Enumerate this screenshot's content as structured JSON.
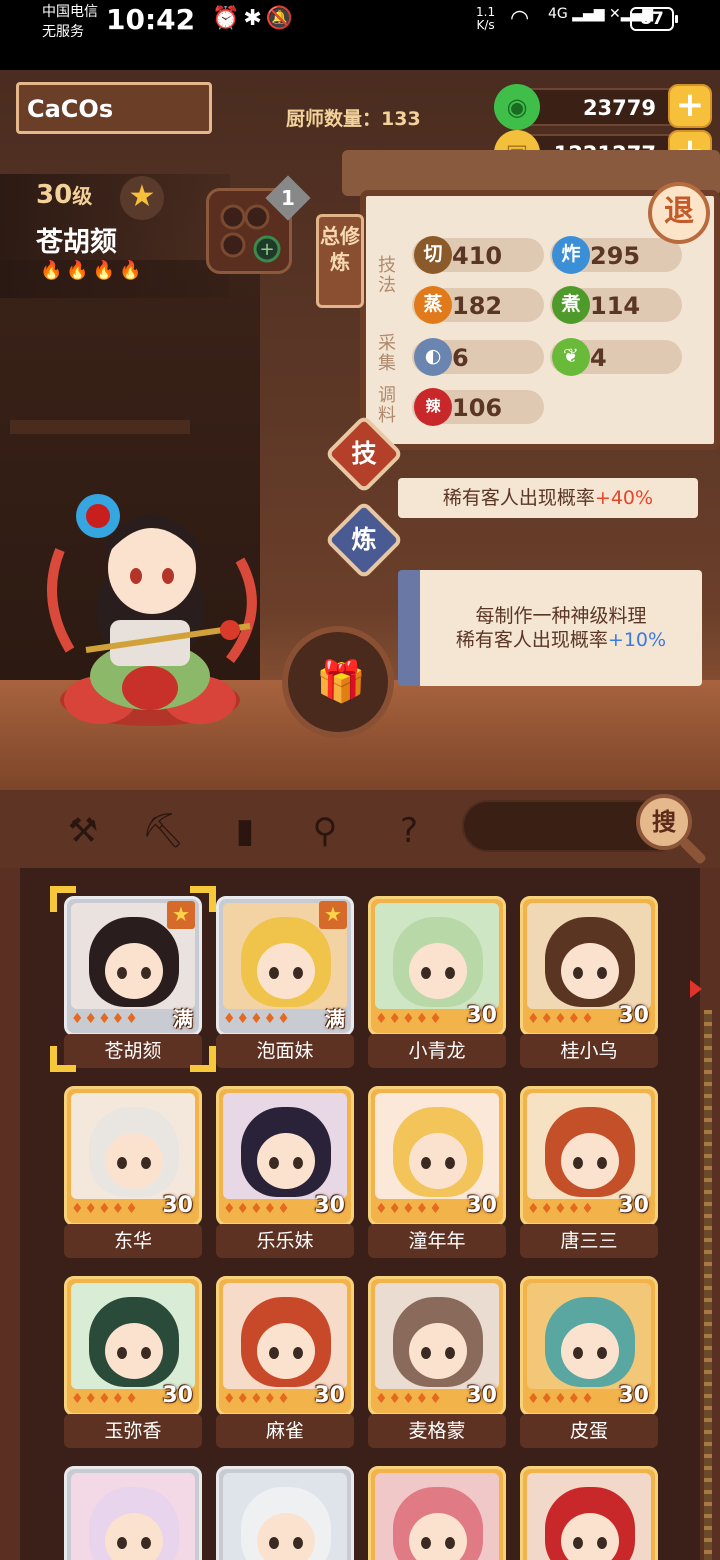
{
  "status_bar": {
    "carrier_line1": "中国电信",
    "carrier_line2": "无服务",
    "time": "10:42",
    "speed_line1": "1.1",
    "speed_line2": "K/s",
    "network": "4G",
    "battery": "87"
  },
  "header": {
    "player_name": "CaCOs",
    "chef_count_label": "厨师数量：",
    "chef_count": "133",
    "jade": "23779",
    "gold": "1221277",
    "exit_label": "退"
  },
  "character": {
    "level": "30",
    "level_suffix": "级",
    "name": "苍胡颏",
    "flames": 4,
    "equip_badge": "1"
  },
  "skills_panel": {
    "total_tag": "总修炼",
    "label_technique": "技法",
    "label_gather": "采集",
    "label_season": "调料",
    "stats": [
      {
        "icon": "切",
        "value": "410",
        "color": "#8a5a2a"
      },
      {
        "icon": "炸",
        "value": "295",
        "color": "#3a8fd6"
      },
      {
        "icon": "蒸",
        "value": "182",
        "color": "#e07a1a"
      },
      {
        "icon": "煮",
        "value": "114",
        "color": "#4e9a2a"
      },
      {
        "icon": "fish-icon",
        "value": "6",
        "color": "#6a86b0"
      },
      {
        "icon": "veg-icon",
        "value": "4",
        "color": "#6aba3a"
      },
      {
        "icon": "辣",
        "value": "106",
        "color": "#c8282a"
      }
    ],
    "skill_button": "技",
    "refine_button": "炼",
    "bonus1_text": "稀有客人出现概率",
    "bonus1_value": "+40%",
    "bonus2_line1": "每制作一种神级料理",
    "bonus2_line2": "稀有客人出现概率",
    "bonus2_value": "+10%"
  },
  "toolbar": {
    "search_label": "搜"
  },
  "chefs": [
    {
      "name": "苍胡颏",
      "level": "满",
      "star": true,
      "selected": true,
      "bg": "#e9e2de",
      "hair": "#2a1d1d"
    },
    {
      "name": "泡面妹",
      "level": "满",
      "star": true,
      "selected": false,
      "bg": "#f3d3a4",
      "hair": "#f0c44a"
    },
    {
      "name": "小青龙",
      "level": "30",
      "star": false,
      "selected": false,
      "bg": "#cfe6c4",
      "hair": "#b8d8a8"
    },
    {
      "name": "桂小乌",
      "level": "30",
      "star": false,
      "selected": false,
      "bg": "#f0d8b4",
      "hair": "#5a3622"
    },
    {
      "name": "东华",
      "level": "30",
      "star": false,
      "selected": false,
      "bg": "#f4e8dc",
      "hair": "#e9e6e2"
    },
    {
      "name": "乐乐妹",
      "level": "30",
      "star": false,
      "selected": false,
      "bg": "#e8d8e6",
      "hair": "#2a2238"
    },
    {
      "name": "潼年年",
      "level": "30",
      "star": false,
      "selected": false,
      "bg": "#fbe8d8",
      "hair": "#f2c45a"
    },
    {
      "name": "唐三三",
      "level": "30",
      "star": false,
      "selected": false,
      "bg": "#f6e2c2",
      "hair": "#c4502a"
    },
    {
      "name": "玉弥香",
      "level": "30",
      "star": false,
      "selected": false,
      "bg": "#d8ecd6",
      "hair": "#2a4a3a"
    },
    {
      "name": "麻雀",
      "level": "30",
      "star": false,
      "selected": false,
      "bg": "#f6dcc8",
      "hair": "#c8482a"
    },
    {
      "name": "麦格蒙",
      "level": "30",
      "star": false,
      "selected": false,
      "bg": "#eadcd0",
      "hair": "#8a6a5a"
    },
    {
      "name": "皮蛋",
      "level": "30",
      "star": false,
      "selected": false,
      "bg": "#f2c878",
      "hair": "#5aa6a0"
    },
    {
      "name": "",
      "level": "",
      "star": false,
      "selected": false,
      "bg": "#f3d8e6",
      "hair": "#e8d4ec"
    },
    {
      "name": "",
      "level": "",
      "star": false,
      "selected": false,
      "bg": "#dfe4ea",
      "hair": "#eef0f2"
    },
    {
      "name": "",
      "level": "",
      "star": false,
      "selected": false,
      "bg": "#f0c8c8",
      "hair": "#e07a84"
    },
    {
      "name": "",
      "level": "",
      "star": false,
      "selected": false,
      "bg": "#f2d8c8",
      "hair": "#c8282a"
    }
  ]
}
